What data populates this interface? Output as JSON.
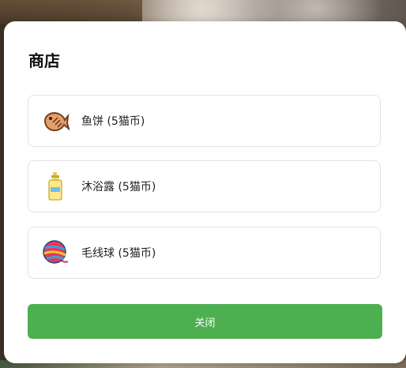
{
  "shop": {
    "title": "商店",
    "items": [
      {
        "name": "鱼饼 (5猫币)",
        "icon": "fish-cake-icon"
      },
      {
        "name": "沐浴露 (5猫币)",
        "icon": "body-wash-bottle-icon"
      },
      {
        "name": "毛线球 (5猫币)",
        "icon": "yarn-ball-icon"
      }
    ],
    "close_label": "关闭"
  },
  "colors": {
    "accent": "#4caf50",
    "card_border": "#e3e3e3"
  }
}
